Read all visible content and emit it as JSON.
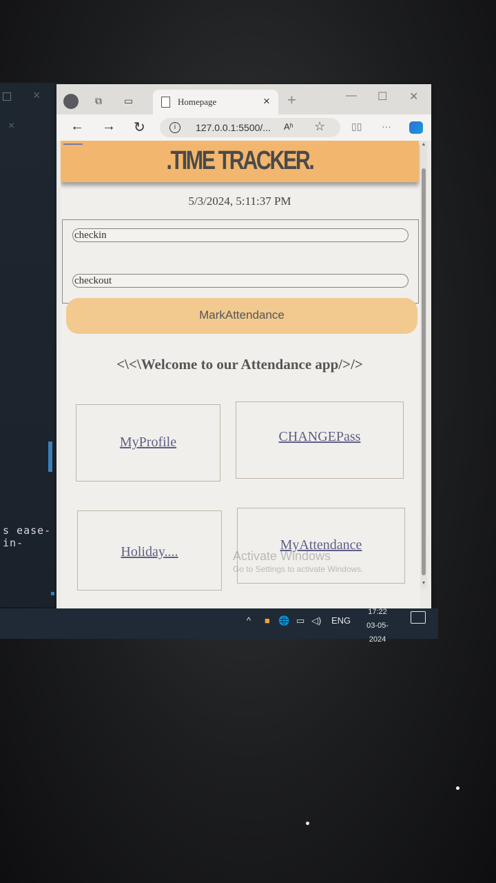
{
  "editor": {
    "code_snippet": "s ease-in-"
  },
  "browser": {
    "tab_title": "Homepage",
    "tab_close": "×",
    "new_tab": "+",
    "address": "127.0.0.1:5500/...",
    "read_aloud": "Aʱ",
    "nav": {
      "back": "←",
      "forward": "→",
      "refresh": "↻"
    },
    "more": "···"
  },
  "app": {
    "brand": ".TIME TRACKER.",
    "datetime": "5/3/2024, 5:11:37 PM",
    "checkin_value": "checkin",
    "checkout_value": "checkout",
    "mark_button": "MarkAttendance",
    "welcome": "<\\<\\Welcome to our Attendance app/>/>",
    "links": [
      "MyProfile",
      "CHANGEPass",
      "Holiday....",
      "MyAttendance"
    ]
  },
  "overlay": {
    "activate_title": "Activate Windows",
    "activate_sub": "Go to Settings to activate Windows."
  },
  "taskbar": {
    "language": "ENG",
    "time": "17:22",
    "date": "03-05-2024"
  },
  "colors": {
    "header": "#f2b66e",
    "button": "#f2c98f",
    "link": "#5e5f86",
    "taskbar": "#202a36"
  }
}
